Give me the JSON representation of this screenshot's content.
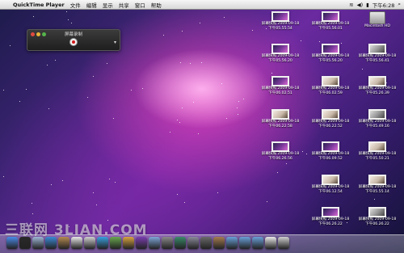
{
  "menubar": {
    "apple_glyph": "",
    "app_name": "QuickTime Player",
    "menus": [
      "文件",
      "编辑",
      "显示",
      "共享",
      "窗口",
      "帮助"
    ],
    "status_time": "下午6:28",
    "battery_glyph": "▮",
    "wifi_glyph": "≋",
    "volume_glyph": "◀)",
    "spotlight_glyph": "⌕"
  },
  "recording_window": {
    "title": "屏幕录制",
    "menu_glyph": "▾"
  },
  "desktop": {
    "hd_label": "Macintosh HD",
    "icons": [
      {
        "l1": "屏幕快照 2009-09-18",
        "l2": "下午05.55.54",
        "thumb": "t0"
      },
      {
        "l1": "屏幕快照 2009-09-18",
        "l2": "下午05.56.01",
        "thumb": "t0"
      },
      {
        "l1": "屏幕快照 2009-09-18",
        "l2": "下午05.56.20",
        "thumb": "t0"
      },
      {
        "l1": "屏幕快照 2009-09-18",
        "l2": "下午05.56.20",
        "thumb": "t0"
      },
      {
        "l1": "屏幕快照 2009-09-18",
        "l2": "下午05.56.41",
        "thumb": "t2"
      },
      {
        "l1": "屏幕快照 2009-09-18",
        "l2": "下午06.02.51",
        "thumb": "t0"
      },
      {
        "l1": "屏幕快照 2009-09-18",
        "l2": "下午06.02.59",
        "thumb": "t1"
      },
      {
        "l1": "屏幕快照 2009-09-18",
        "l2": "下午05.26.39",
        "thumb": "t1"
      },
      {
        "l1": "屏幕快照 2009-09-18",
        "l2": "下午06.22.58",
        "thumb": "t1"
      },
      {
        "l1": "屏幕快照 2009-09-18",
        "l2": "下午06.22.52",
        "thumb": "t1"
      },
      {
        "l1": "屏幕快照 2009-09-18",
        "l2": "下午05.49.16",
        "thumb": "t2"
      },
      {
        "l1": "屏幕快照 2009-09-18",
        "l2": "下午06.26.56",
        "thumb": "t0"
      },
      {
        "l1": "屏幕快照 2009-09-18",
        "l2": "下午06.09.52",
        "thumb": "t0"
      },
      {
        "l1": "屏幕快照 2009-09-18",
        "l2": "下午05.50.21",
        "thumb": "t1"
      },
      {
        "l1": "屏幕快照 2009-09-18",
        "l2": "下午06.12.54",
        "thumb": "t1"
      },
      {
        "l1": "屏幕快照 2009-09-18",
        "l2": "下午05.55.14",
        "thumb": "t1"
      },
      {
        "l1": "屏幕快照 2009-09-18",
        "l2": "下午06.26.22",
        "thumb": "t0"
      },
      {
        "l1": "屏幕快照 2009-09-18",
        "l2": "下午06.26.22",
        "thumb": "t2"
      }
    ]
  },
  "watermark": "三联网 3LIAN.COM",
  "dock": {
    "items": [
      {
        "name": "finder-icon",
        "color": "#4a8ae8"
      },
      {
        "name": "dashboard-icon",
        "color": "#2a2a2a"
      },
      {
        "name": "mail-icon",
        "color": "#9fb6d6"
      },
      {
        "name": "safari-icon",
        "color": "#3a8ad6"
      },
      {
        "name": "address-book-icon",
        "color": "#b58a52"
      },
      {
        "name": "ical-icon",
        "color": "#e8e8e8"
      },
      {
        "name": "preview-icon",
        "color": "#cfcfcf"
      },
      {
        "name": "itunes-icon",
        "color": "#3aa0e0"
      },
      {
        "name": "iphoto-icon",
        "color": "#6aa84f"
      },
      {
        "name": "garageband-icon",
        "color": "#d9a441"
      },
      {
        "name": "imovie-icon",
        "color": "#7a3fb0"
      },
      {
        "name": "ichat-icon",
        "color": "#7fa6d8"
      },
      {
        "name": "xcode-icon",
        "color": "#8a8a8a"
      },
      {
        "name": "time-machine-icon",
        "color": "#3a8a6a"
      },
      {
        "name": "system-preferences-icon",
        "color": "#8a8a9a"
      },
      {
        "name": "network-icon",
        "color": "#6a6a6a"
      },
      {
        "name": "tools-icon",
        "color": "#a67c4f"
      },
      {
        "name": "stacks-icon",
        "color": "#6aa0d8"
      },
      {
        "name": "applications-folder-icon",
        "color": "#6aa0d8"
      },
      {
        "name": "documents-folder-icon",
        "color": "#6aa0d8"
      },
      {
        "name": "downloads-stack-icon",
        "color": "#eaeaea"
      },
      {
        "name": "trash-icon",
        "color": "#cfcfcf"
      }
    ]
  }
}
